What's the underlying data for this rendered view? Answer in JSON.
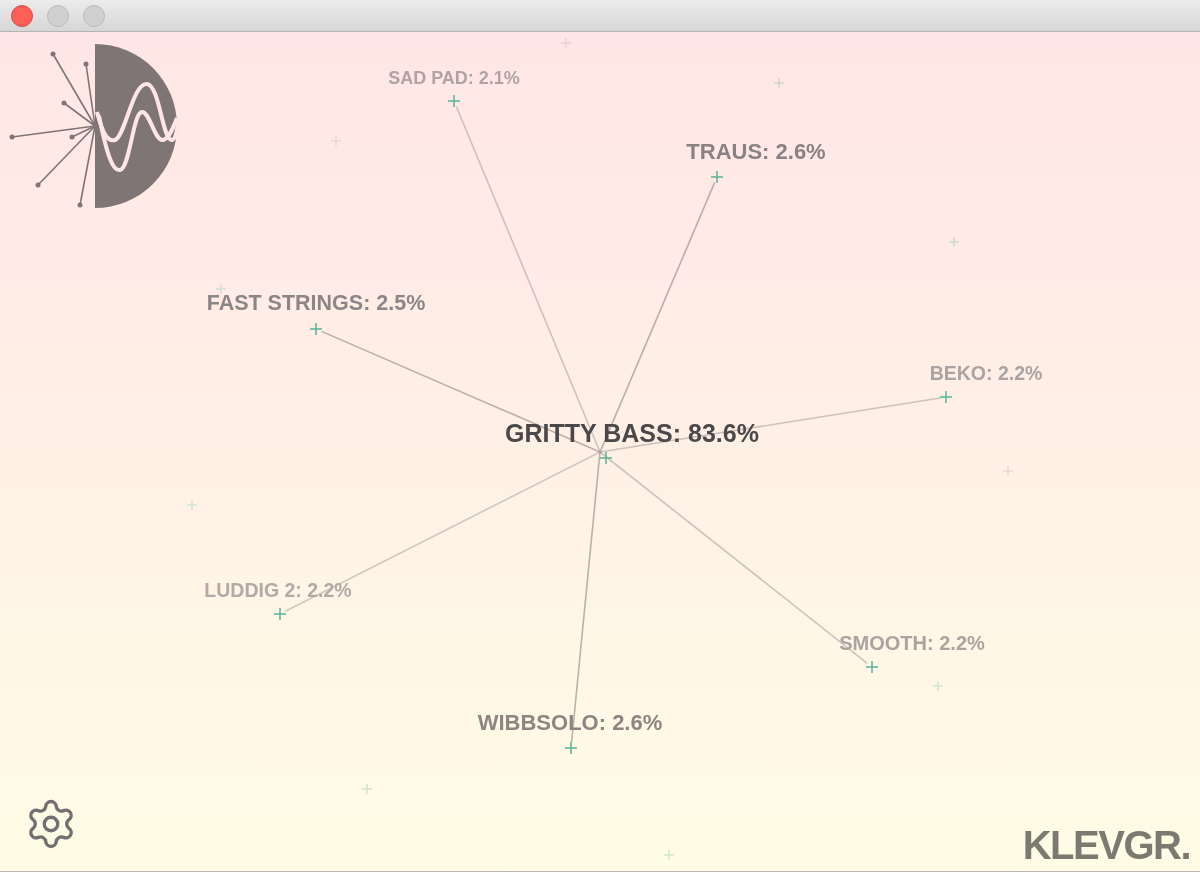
{
  "window": {
    "buttons": [
      {
        "kind": "close",
        "disabled": false
      },
      {
        "kind": "minimize",
        "disabled": true
      },
      {
        "kind": "zoom",
        "disabled": true
      }
    ]
  },
  "nodes": [
    {
      "label": "SAD PAD: 2.1%",
      "color": "#b1a3a3"
    },
    {
      "label": "TRAUS: 2.6%",
      "color": "#8a8282"
    },
    {
      "label": "FAST STRINGS: 2.5%",
      "color": "#8c8585"
    },
    {
      "label": "BEKO: 2.2%",
      "color": "#aba3a2"
    },
    {
      "label": "GRITTY BASS: 83.6%",
      "color": "#4a4848"
    },
    {
      "label": "LUDDIG 2: 2.2%",
      "color": "#b2aaa6"
    },
    {
      "label": "SMOOTH: 2.2%",
      "color": "#aaa4a0"
    },
    {
      "label": "WIBBSOLO: 2.6%",
      "color": "#8b8682"
    }
  ],
  "brand": "KLEVGR."
}
